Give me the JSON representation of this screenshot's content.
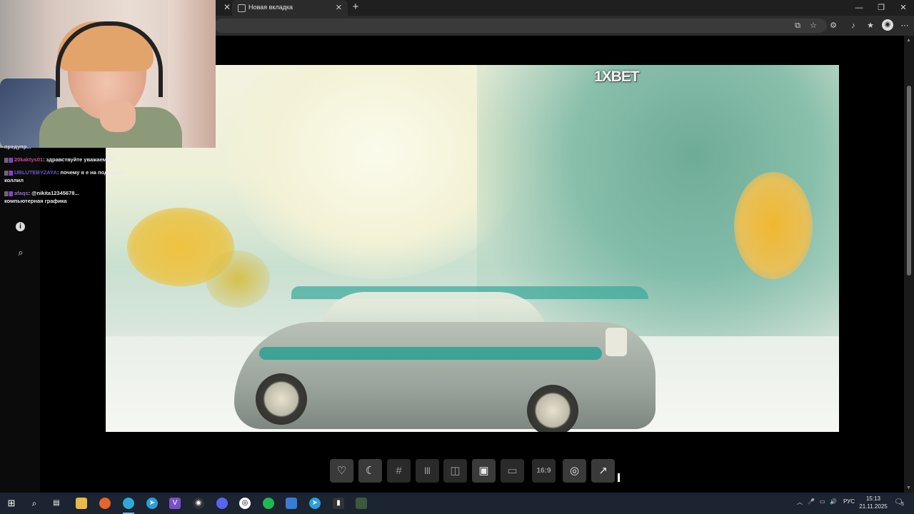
{
  "browser": {
    "tabs": [
      {
        "label": "Новая вкладка",
        "active": true
      }
    ],
    "new_tab_symbol": "+",
    "window_controls": [
      "minimize",
      "restore",
      "close"
    ],
    "toolbar_icons": [
      "split-screen-icon",
      "favorite-star-icon",
      "extensions-icon",
      "media-control-icon",
      "favorites-icon",
      "profile-icon",
      "more-icon"
    ]
  },
  "chat": {
    "messages": [
      {
        "user": "20kaktys01",
        "user_color": "#c74b9c",
        "text": ": здравствуйте уважаемый"
      },
      {
        "user": "UBLUTEBYZAYA",
        "user_color": "#6a5acd",
        "text": ": почему я е          на подпишен"
      },
      {
        "user": "",
        "user_color": "#eaeaea",
        "text": "коллил"
      },
      {
        "user": "afaqs",
        "user_color": "#8e6bd1",
        "text": ": @nikita12345678..."
      },
      {
        "user": "",
        "user_color": "#eaeaea",
        "text": "компьютерная графика"
      }
    ],
    "header_fragment": "предупр..."
  },
  "sidebar": {
    "icons": [
      "info-icon",
      "search-icon"
    ]
  },
  "video": {
    "watermark": "1XBET"
  },
  "player_controls": [
    {
      "name": "like-button",
      "icon": "heart-icon",
      "symbol": "♡"
    },
    {
      "name": "dark-mode-button",
      "icon": "moon-icon",
      "symbol": "☾"
    },
    {
      "name": "grid-button",
      "icon": "grid-icon",
      "symbol": "#"
    },
    {
      "name": "audio-button",
      "icon": "waveform-icon",
      "symbol": "|||"
    },
    {
      "name": "mirror-button",
      "icon": "mirror-icon",
      "symbol": "◫"
    },
    {
      "name": "picture-button",
      "icon": "picture-icon",
      "symbol": "▣"
    },
    {
      "name": "pip-button",
      "icon": "pip-icon",
      "symbol": "▭"
    },
    {
      "name": "aspect-ratio-button",
      "icon": "aspect-ratio-icon",
      "symbol": "16:9"
    },
    {
      "name": "screenshot-button",
      "icon": "screenshot-icon",
      "symbol": "◎"
    },
    {
      "name": "popout-button",
      "icon": "popout-icon",
      "symbol": "↗"
    }
  ],
  "taskbar": {
    "apps": [
      "start-icon",
      "search-icon",
      "task-view-icon",
      "file-explorer-icon",
      "firefox-icon",
      "edge-icon",
      "telegram-icon",
      "visual-studio-icon",
      "obs-icon",
      "discord-icon",
      "ubisoft-icon",
      "spotify-icon",
      "remote-desktop-icon",
      "telegram-icon-2",
      "terminal-icon",
      "nvidia-icon"
    ],
    "tray": {
      "language": "РУС",
      "time": "15:13",
      "date": "21.11.2025",
      "notifications": "5"
    }
  }
}
